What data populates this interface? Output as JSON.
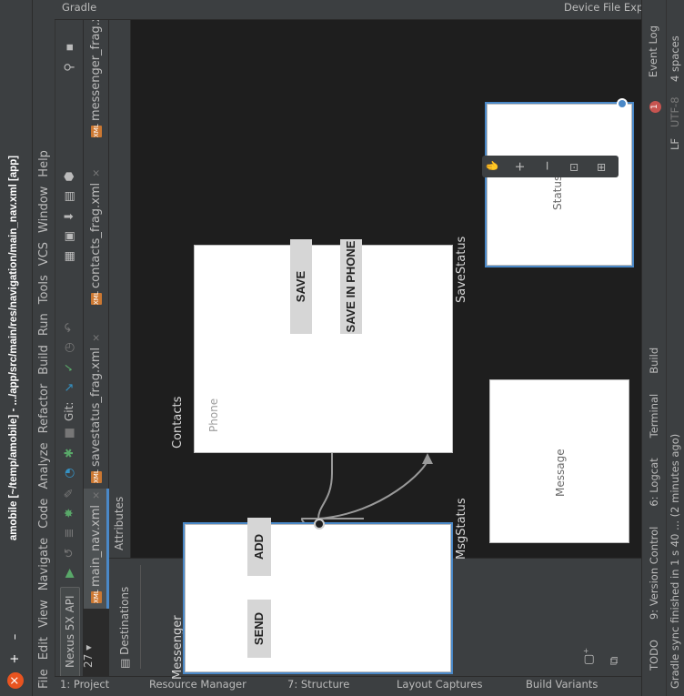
{
  "window": {
    "title": "amobile [~/temp/amobile] - .../app/src/main/res/navigation/main_nav.xml [app]"
  },
  "menu": [
    "File",
    "Edit",
    "View",
    "Navigate",
    "Code",
    "Analyze",
    "Refactor",
    "Build",
    "Run",
    "Tools",
    "VCS",
    "Window",
    "Help"
  ],
  "toolbar": {
    "device": "Nexus 5X API 27",
    "git_label": "Git:"
  },
  "tabs": [
    {
      "label": "main_nav.xml"
    },
    {
      "label": "savestatus_frag.xml"
    },
    {
      "label": "contacts_frag.xml"
    },
    {
      "label": "messenger_frag.xml"
    }
  ],
  "left_strip": {
    "project": "1: Project",
    "resource_manager": "Resource Manager",
    "structure": "7: Structure",
    "layout_captures": "Layout Captures",
    "build_variants": "Build Variants"
  },
  "right_strip": {
    "gradle": "Gradle",
    "device_file_explorer": "Device File Explorer"
  },
  "bottom_tools": [
    {
      "label": "TODO"
    },
    {
      "label": "9: Version Control"
    },
    {
      "label": "6: Logcat"
    },
    {
      "label": "Terminal"
    },
    {
      "label": "Build"
    }
  ],
  "event_log": {
    "count": "1",
    "label": "Event Log"
  },
  "status": {
    "message": "Gradle sync finished in 1 s 40 ... (2 minutes ago)",
    "lf": "LF",
    "encoding": "UTF-8",
    "indent": "4 spaces"
  },
  "panels": {
    "attributes": "Attributes",
    "destinations": "Destinations"
  },
  "nav": {
    "messenger": {
      "title": "Messenger",
      "buttons": [
        "SEND",
        "ADD"
      ]
    },
    "contacts": {
      "title": "Contacts",
      "hint": "Phone",
      "buttons": [
        "SAVE",
        "SAVE IN PHONE"
      ]
    },
    "savestatus": {
      "title": "SaveStatus",
      "text": "Status"
    },
    "msgstatus": {
      "title": "MsgStatus",
      "text": "Message"
    }
  }
}
